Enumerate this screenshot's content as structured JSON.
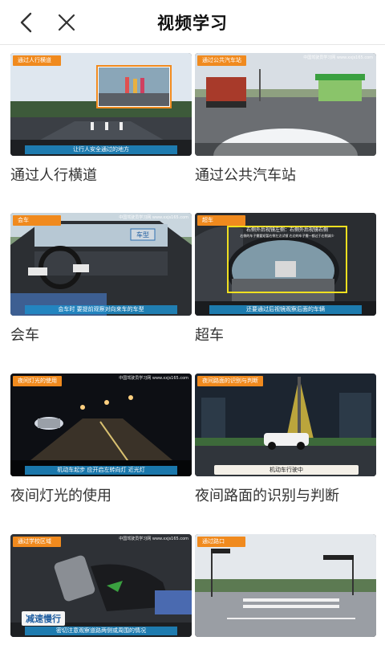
{
  "header": {
    "title": "视频学习",
    "back_icon": "chevron-left-icon",
    "close_icon": "close-icon"
  },
  "colors": {
    "tag_bg": "#f08a1e",
    "caption_bg": "#1e8cc8"
  },
  "videos": [
    {
      "label": "通过人行横道",
      "tag": "通过人行横道",
      "caption": "让行人安全通过的地方",
      "watermark": ""
    },
    {
      "label": "通过公共汽车站",
      "tag": "通过公共汽车站",
      "caption": "",
      "watermark": "中国驾驶员学习网 www.xxjs165.com"
    },
    {
      "label": "会车",
      "tag": "会车",
      "caption": "会车时 要提前观察对向来车的车型",
      "watermark": "中国驾驶员学习网 www.xxjs165.com",
      "overlay": "车型"
    },
    {
      "label": "超车",
      "tag": "超车",
      "caption": "还要通过后视镜观察后面的车辆",
      "watermark": "",
      "overlay": "右侧外后视镜左侧：右侧外后视镜右侧",
      "overlay2": "右侧的车子需要短暂右侧左边试镜  右边的车子需一都过于右侧减少"
    },
    {
      "label": "夜间灯光的使用",
      "tag": "夜间灯光的使用",
      "caption": "机动车起步 应开启左转向灯 近光灯",
      "watermark": "中国驾驶员学习网 www.xxjs165.com"
    },
    {
      "label": "夜间路面的识别与判断",
      "tag": "夜间路面的识别与判断",
      "caption": "机动车行驶中",
      "watermark": ""
    },
    {
      "label": "",
      "tag": "通过学校区域",
      "caption": "密切注意观察道路两侧或周围的情况",
      "watermark": "中国驾驶员学习网 www.xxjs165.com",
      "overlay": "减速慢行"
    },
    {
      "label": "",
      "tag": "通过路口",
      "caption": "",
      "watermark": ""
    }
  ]
}
